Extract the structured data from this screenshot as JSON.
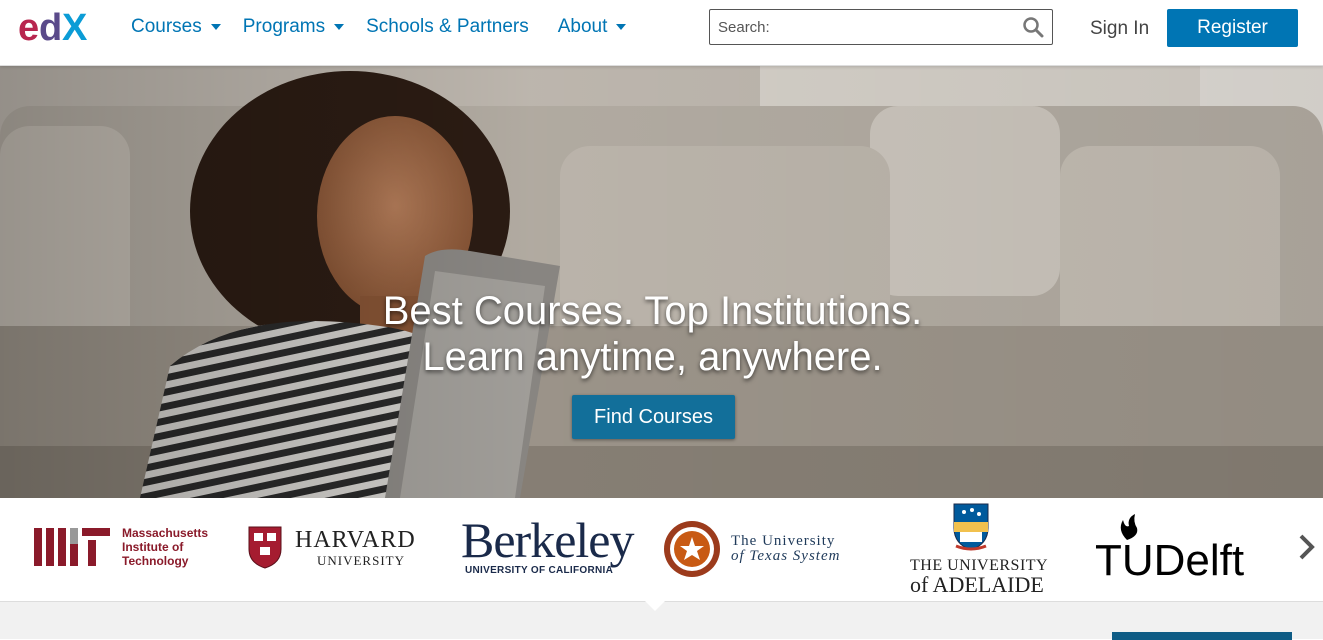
{
  "header": {
    "logo_alt": "edX",
    "nav": [
      {
        "label": "Courses",
        "has_dropdown": true
      },
      {
        "label": "Programs",
        "has_dropdown": true
      },
      {
        "label": "Schools & Partners",
        "has_dropdown": false
      },
      {
        "label": "About",
        "has_dropdown": true
      }
    ],
    "search_placeholder": "Search:",
    "sign_in": "Sign In",
    "register": "Register"
  },
  "hero": {
    "line1": "Best Courses. Top Institutions.",
    "line2": "Learn anytime, anywhere.",
    "cta": "Find Courses"
  },
  "partners": {
    "mit": {
      "line1": "Massachusetts",
      "line2": "Institute of",
      "line3": "Technology"
    },
    "harvard": {
      "name": "HARVARD",
      "sub": "UNIVERSITY"
    },
    "berkeley": {
      "name": "Berkeley",
      "sub": "UNIVERSITY OF CALIFORNIA"
    },
    "ut": {
      "line1": "The University",
      "line2": "of Texas System"
    },
    "adelaide": {
      "line1": "THE UNIVERSITY",
      "line2": "of ADELAIDE"
    },
    "tudelft": {
      "name": "TUDelft"
    }
  },
  "colors": {
    "brand_blue": "#0075b4",
    "cta_blue": "#126f9a",
    "mit_red": "#8a1a2a"
  }
}
